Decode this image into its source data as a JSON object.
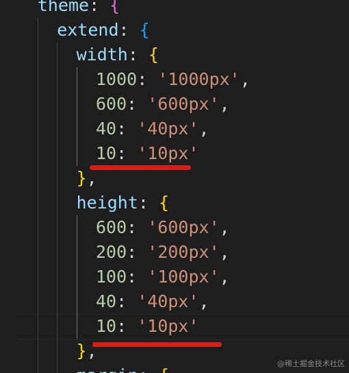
{
  "editor": {
    "lines": [
      {
        "k": "theme",
        "open": "{",
        "bc": "b1"
      },
      {
        "k": "extend",
        "open": "{",
        "bc": "b2"
      },
      {
        "k": "width",
        "open": "{",
        "bc": "b3"
      },
      {
        "n": "1000",
        "v": "'1000px'",
        "c": ","
      },
      {
        "n": "600",
        "v": "'600px'",
        "c": ","
      },
      {
        "n": "40",
        "v": "'40px'",
        "c": ","
      },
      {
        "n": "10",
        "v": "'10px'",
        "c": ""
      },
      {
        "close": "}",
        "bc": "b3",
        "c": ","
      },
      {
        "k": "height",
        "open": "{",
        "bc": "b3"
      },
      {
        "n": "600",
        "v": "'600px'",
        "c": ","
      },
      {
        "n": "200",
        "v": "'200px'",
        "c": ","
      },
      {
        "n": "100",
        "v": "'100px'",
        "c": ","
      },
      {
        "n": "40",
        "v": "'40px'",
        "c": ","
      },
      {
        "n": "10",
        "v": "'10px'",
        "c": ""
      },
      {
        "close": "}",
        "bc": "b3",
        "c": ","
      },
      {
        "k": "margin",
        "open": "{",
        "bc": "b3"
      }
    ]
  },
  "annotations": {
    "underline_color": "#e8170f"
  },
  "watermark": "@稀土掘金技术社区"
}
